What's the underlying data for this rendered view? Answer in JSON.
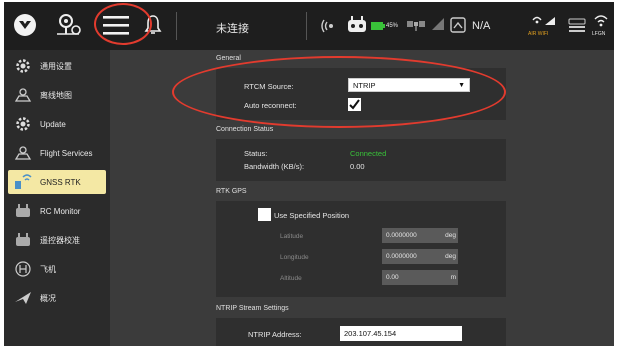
{
  "colors": {
    "accent_red": "#e23b2e",
    "connected_green": "#39c239",
    "active_item_bg": "#f4e8a4",
    "wifi_label": "#e2a020"
  },
  "topbar": {
    "logo_icon": "logo-icon",
    "menu_icon": "hamburger-menu-icon",
    "notification_icon": "bell-icon",
    "connection_label": "未连接",
    "battery_percent": "45%",
    "signal_label": "N/A",
    "airwifi_label": "AIR WIFI",
    "gnss_label": "LFGN"
  },
  "sidebar": {
    "items": [
      {
        "label": "通用设置",
        "icon": "gear-icon",
        "active": false
      },
      {
        "label": "离线地图",
        "icon": "map-icon",
        "active": false
      },
      {
        "label": "Update",
        "icon": "update-icon",
        "active": false
      },
      {
        "label": "Flight Services",
        "icon": "flight-services-icon",
        "active": false
      },
      {
        "label": "GNSS RTK",
        "icon": "gnss-rtk-icon",
        "active": true
      },
      {
        "label": "RC Monitor",
        "icon": "rc-monitor-icon",
        "active": false
      },
      {
        "label": "遥控器校准",
        "icon": "rc-calibration-icon",
        "active": false
      },
      {
        "label": "飞机",
        "icon": "aircraft-icon",
        "active": false
      },
      {
        "label": "概况",
        "icon": "summary-icon",
        "active": false
      }
    ]
  },
  "general": {
    "title": "General",
    "rtcm_label": "RTCM Source:",
    "rtcm_value": "NTRIP",
    "auto_reconnect_label": "Auto reconnect:",
    "auto_reconnect_checked": true
  },
  "connection": {
    "title": "Connection Status",
    "status_label": "Status:",
    "status_value": "Connected",
    "bandwidth_label": "Bandwidth (KB/s):",
    "bandwidth_value": "0.00"
  },
  "rtk_gps": {
    "title": "RTK GPS",
    "use_position_label": "Use Specified Position",
    "latitude_label": "Latitude",
    "latitude_value": "0.0000000",
    "latitude_unit": "deg",
    "longitude_label": "Longitude",
    "longitude_value": "0.0000000",
    "longitude_unit": "deg",
    "altitude_label": "Altitude",
    "altitude_value": "0.00",
    "altitude_unit": "m"
  },
  "ntrip": {
    "title": "NTRIP Stream Settings",
    "address_label": "NTRIP Address:",
    "address_value": "203.107.45.154"
  }
}
